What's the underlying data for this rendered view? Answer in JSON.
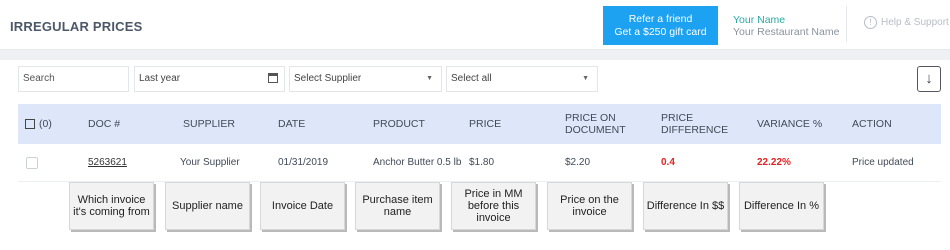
{
  "header": {
    "title": "IRREGULAR PRICES",
    "refer_line1": "Refer a friend",
    "refer_line2": "Get a $250 gift card",
    "user_name": "Your Name",
    "restaurant_name": "Your Restaurant Name",
    "help_label": "Help & Support",
    "help_icon": "!"
  },
  "filters": {
    "search_placeholder": "Search",
    "date_range": "Last year",
    "supplier": "Select Supplier",
    "select_all": "Select all",
    "download_icon": "↓"
  },
  "table": {
    "columns": {
      "select": "(0)",
      "doc": "DOC #",
      "supplier": "SUPPLIER",
      "date": "DATE",
      "product": "PRODUCT",
      "price": "PRICE",
      "price_on_document": "PRICE ON DOCUMENT",
      "price_difference": "PRICE DIFFERENCE",
      "variance": "VARIANCE %",
      "action": "ACTION"
    },
    "rows": [
      {
        "doc": "5263621",
        "supplier": "Your Supplier",
        "date": "01/31/2019",
        "product": "Anchor Butter 0.5 lb",
        "price": "$1.80",
        "price_on_document": "$2.20",
        "price_difference": "0.4",
        "variance": "22.22%",
        "action": "Price updated"
      }
    ]
  },
  "callouts": {
    "doc": "Which invoice it's coming from",
    "supplier": "Supplier name",
    "date": "Invoice Date",
    "product": "Purchase item name",
    "price": "Price in MM before this invoice",
    "price_on_document": "Price on the invoice",
    "difference": "Difference In $$",
    "variance": "Difference In %"
  },
  "colors": {
    "accent": "#1ca2f0",
    "header_row": "#dde7f9",
    "alert": "#e02424",
    "user_name": "#2aa9a3"
  }
}
